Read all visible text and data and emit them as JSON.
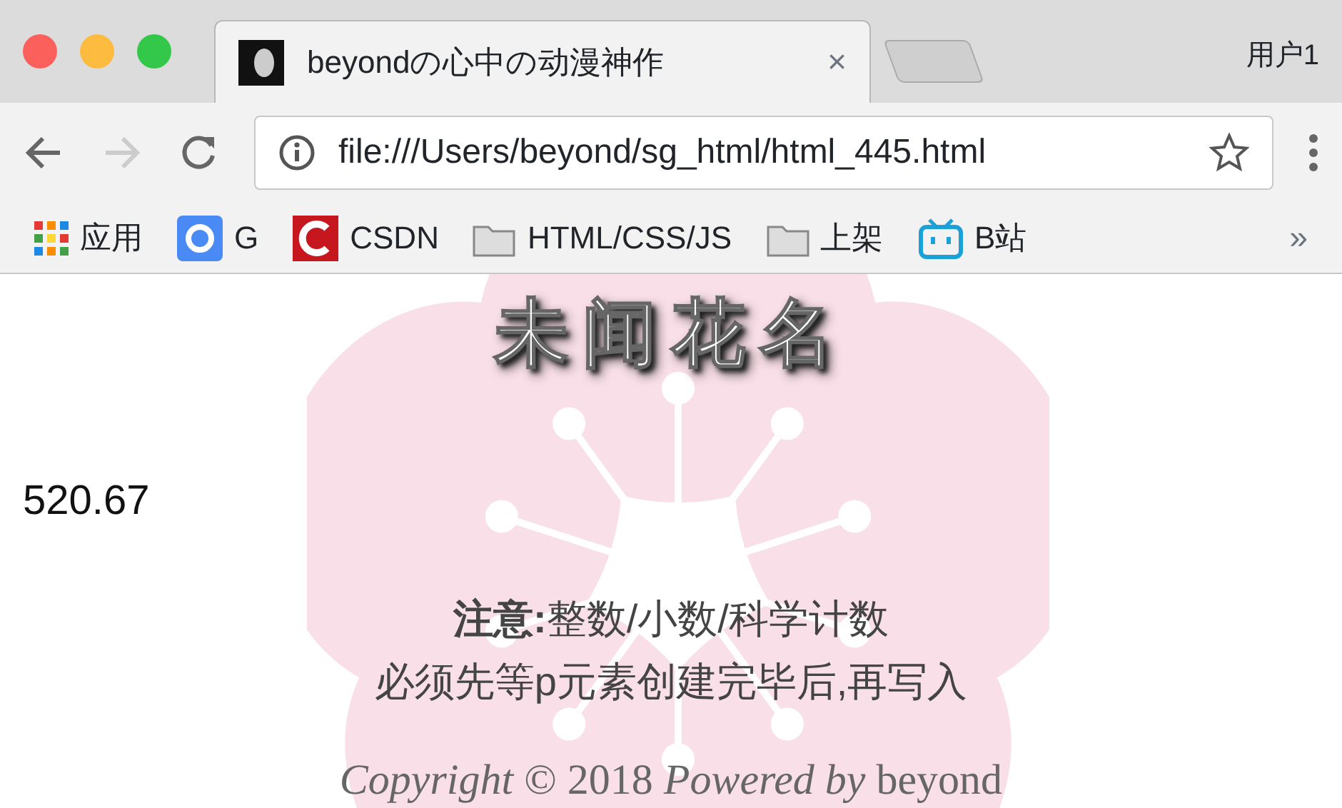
{
  "window": {
    "controls": [
      {
        "kind": "close"
      },
      {
        "kind": "minimize"
      },
      {
        "kind": "zoom"
      }
    ],
    "profile": "用户1"
  },
  "tabs": [
    {
      "title": "beyondの心中の动漫神作",
      "selected": true,
      "close": "×"
    }
  ],
  "toolbar": {
    "back_disabled": false,
    "forward_disabled": true,
    "url": "file:///Users/beyond/sg_html/html_445.html"
  },
  "bookmarks": [
    {
      "kind": "apps",
      "label": "应用"
    },
    {
      "kind": "google",
      "label": "G"
    },
    {
      "kind": "csdn",
      "label": "CSDN"
    },
    {
      "kind": "folder",
      "label": "HTML/CSS/JS"
    },
    {
      "kind": "folder",
      "label": "上架"
    },
    {
      "kind": "bili",
      "label": "B站"
    }
  ],
  "bookmarks_overflow": "»",
  "page": {
    "heading": "未闻花名",
    "value": "520.67",
    "notes": [
      "**注意:**整数/小数/科学计数",
      "必须先等p元素创建完毕后,再写入"
    ],
    "footer": "*Copyright* © 2018 *Powered by* beyond"
  }
}
